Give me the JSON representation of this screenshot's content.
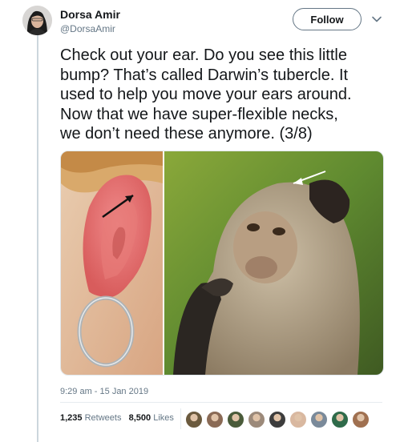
{
  "user": {
    "name": "Dorsa Amir",
    "handle": "@DorsaAmir"
  },
  "follow_label": "Follow",
  "tweet_text": "Check out your ear. Do you see this little\nbump? That’s called Darwin’s tubercle. It\nused to help you move your ears around.\nNow that we have super-flexible necks,\nwe don’t need these anymore. (3/8)",
  "timestamp": "9:29 am - 15 Jan 2019",
  "stats": {
    "retweets_count": "1,235",
    "retweets_label": "Retweets",
    "likes_count": "8,500",
    "likes_label": "Likes"
  },
  "liker_avatars": [
    "#6b5a3e",
    "#8a6a55",
    "#4a5b3a",
    "#9c8a7a",
    "#3d3d3d",
    "#d9b8a0",
    "#7a8a9a",
    "#2f6b4a",
    "#a07050"
  ],
  "colors": {
    "text": "#14171a",
    "secondary": "#657786",
    "thread_line": "#ccd6dd"
  }
}
